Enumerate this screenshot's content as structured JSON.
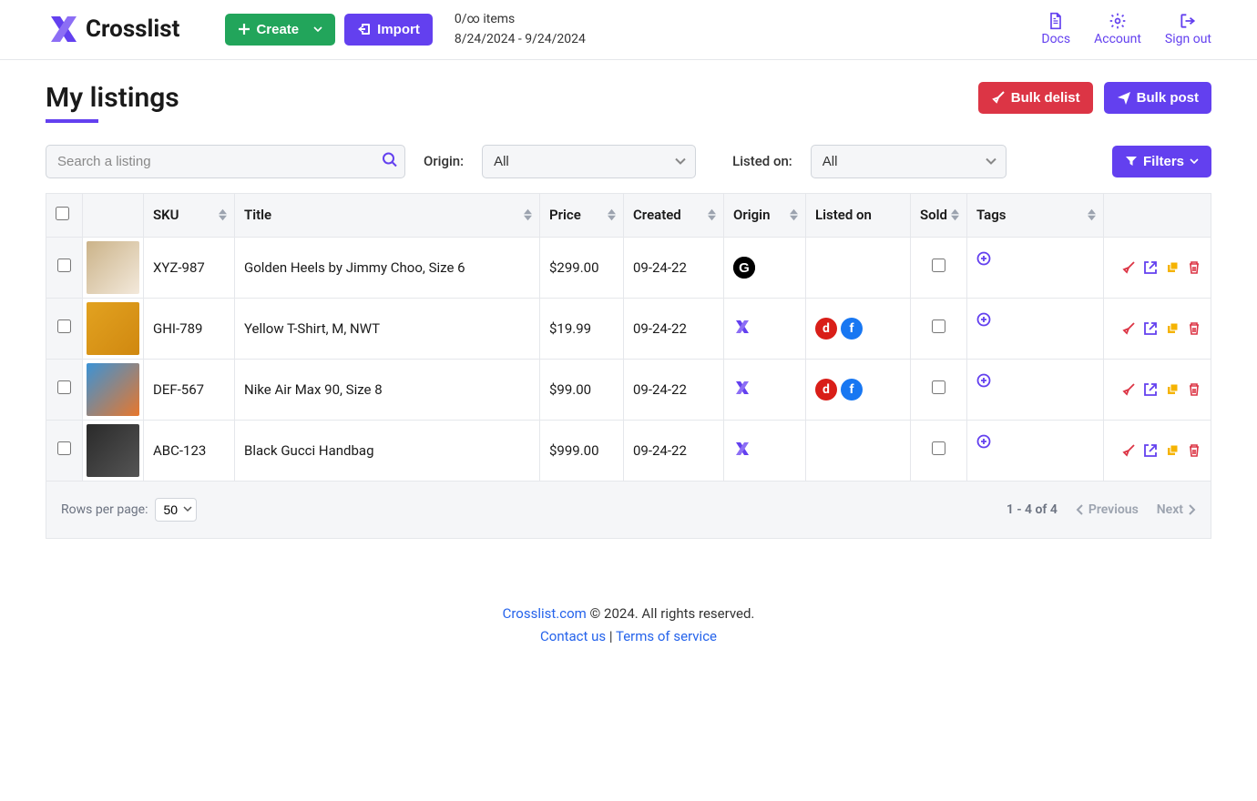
{
  "header": {
    "brand": "Crosslist",
    "create_label": "Create",
    "import_label": "Import",
    "items_status": "0/∞ items",
    "date_range": "8/24/2024 - 9/24/2024",
    "nav": {
      "docs": "Docs",
      "account": "Account",
      "signout": "Sign out"
    }
  },
  "page": {
    "title": "My listings",
    "bulk_delist": "Bulk delist",
    "bulk_post": "Bulk post"
  },
  "filters": {
    "search_placeholder": "Search a listing",
    "origin_label": "Origin:",
    "origin_value": "All",
    "listed_label": "Listed on:",
    "listed_value": "All",
    "filters_btn": "Filters"
  },
  "columns": {
    "sku": "SKU",
    "title": "Title",
    "price": "Price",
    "created": "Created",
    "origin": "Origin",
    "listed": "Listed on",
    "sold": "Sold",
    "tags": "Tags"
  },
  "rows": [
    {
      "sku": "XYZ-987",
      "title": "Golden Heels by Jimmy Choo, Size 6",
      "price": "$299.00",
      "created": "09-24-22",
      "origin": "g",
      "listed": [],
      "thumb_colors": [
        "#cbb389",
        "#f3e9db"
      ]
    },
    {
      "sku": "GHI-789",
      "title": "Yellow T-Shirt, M, NWT",
      "price": "$19.99",
      "created": "09-24-22",
      "origin": "x",
      "listed": [
        "d",
        "f"
      ],
      "thumb_colors": [
        "#e2a220",
        "#d08810"
      ]
    },
    {
      "sku": "DEF-567",
      "title": "Nike Air Max 90, Size 8",
      "price": "$99.00",
      "created": "09-24-22",
      "origin": "x",
      "listed": [
        "d",
        "f"
      ],
      "thumb_colors": [
        "#3b93d6",
        "#e8772c"
      ]
    },
    {
      "sku": "ABC-123",
      "title": "Black Gucci Handbag",
      "price": "$999.00",
      "created": "09-24-22",
      "origin": "x",
      "listed": [],
      "thumb_colors": [
        "#2a2a2a",
        "#555"
      ]
    }
  ],
  "table_footer": {
    "rows_label": "Rows per page:",
    "rows_value": "50",
    "range": "1 - 4 of 4",
    "prev": "Previous",
    "next": "Next"
  },
  "footer": {
    "site": "Crosslist.com",
    "copyright": " © 2024. All rights reserved.",
    "contact": "Contact us",
    "terms": "Terms of service"
  }
}
